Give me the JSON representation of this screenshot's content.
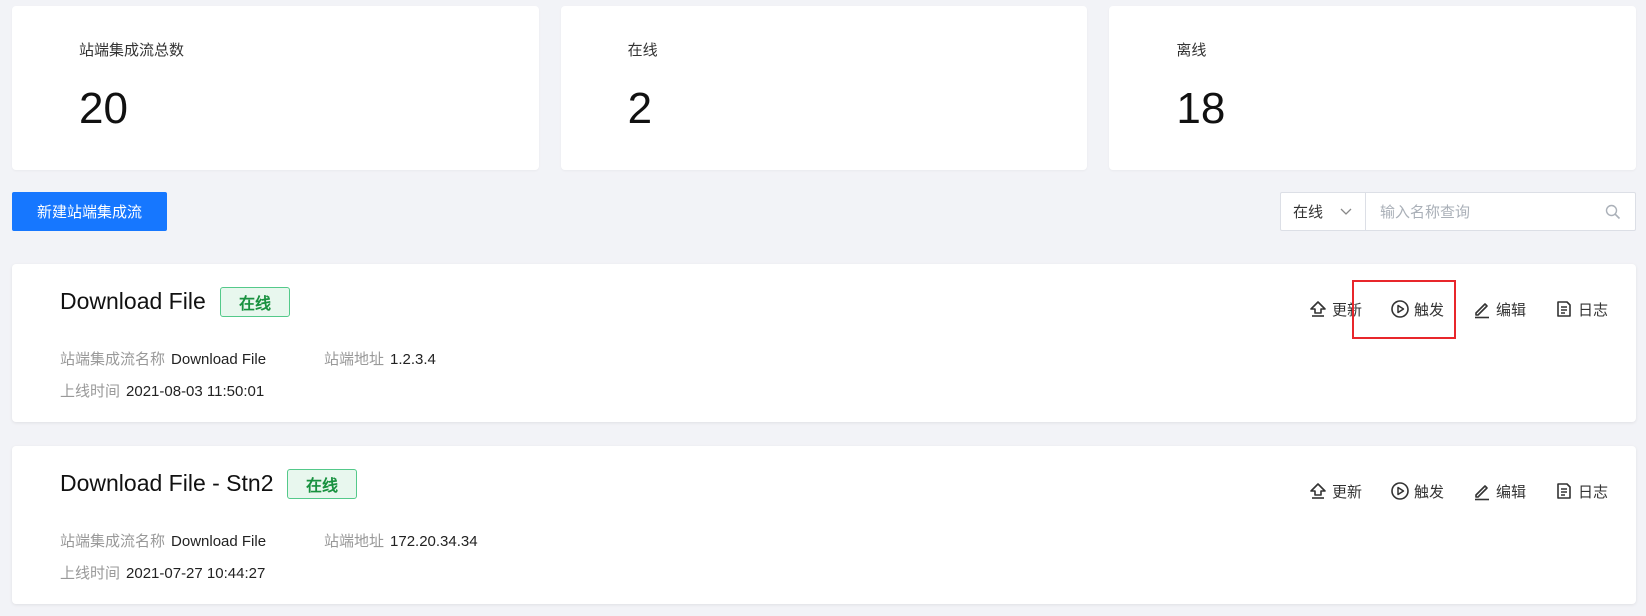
{
  "stats": [
    {
      "label": "站端集成流总数",
      "value": "20"
    },
    {
      "label": "在线",
      "value": "2"
    },
    {
      "label": "离线",
      "value": "18"
    }
  ],
  "toolbar": {
    "create_label": "新建站端集成流",
    "status_value": "在线",
    "search_placeholder": "输入名称查询"
  },
  "flows": [
    {
      "title": "Download File",
      "status": "在线",
      "name_label": "站端集成流名称",
      "name_value": "Download File",
      "addr_label": "站端地址",
      "addr_value": "1.2.3.4",
      "time_label": "上线时间",
      "time_value": "2021-08-03 11:50:01",
      "actions": {
        "update": "更新",
        "trigger": "触发",
        "edit": "编辑",
        "log": "日志"
      }
    },
    {
      "title": "Download File - Stn2",
      "status": "在线",
      "name_label": "站端集成流名称",
      "name_value": "Download File",
      "addr_label": "站端地址",
      "addr_value": "172.20.34.34",
      "time_label": "上线时间",
      "time_value": "2021-07-27 10:44:27",
      "actions": {
        "update": "更新",
        "trigger": "触发",
        "edit": "编辑",
        "log": "日志"
      }
    }
  ],
  "colors": {
    "primary": "#1677ff",
    "online_badge": "#18913f",
    "highlight": "#e8262b"
  }
}
